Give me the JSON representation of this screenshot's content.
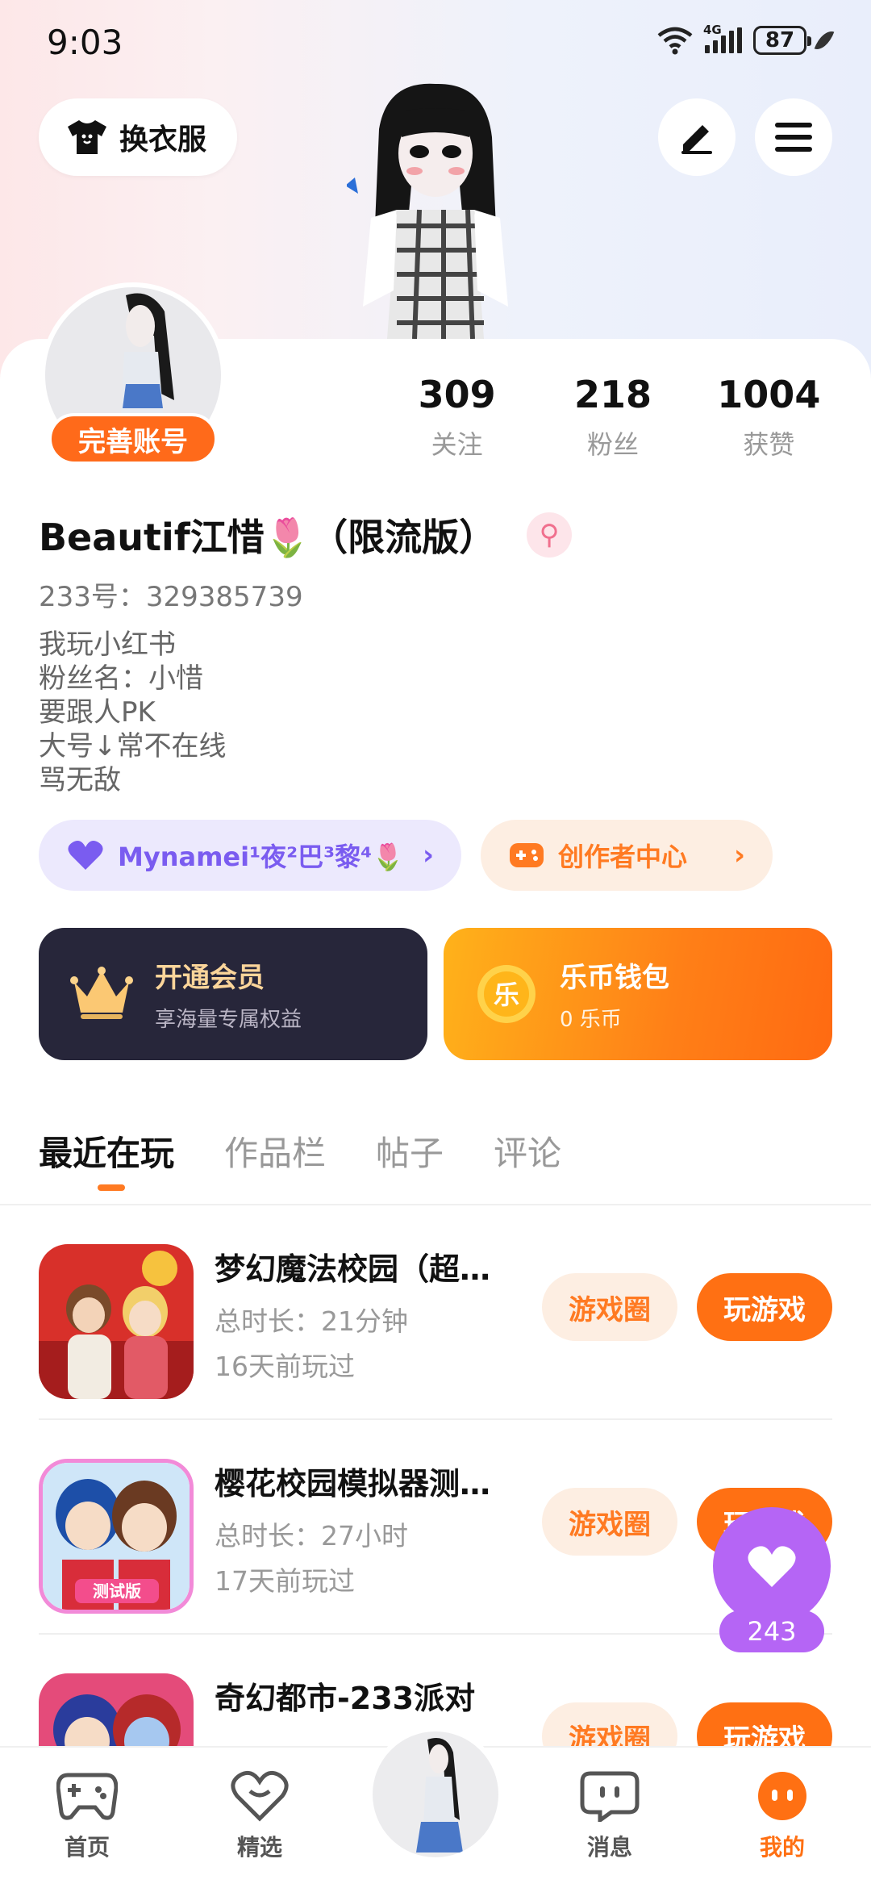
{
  "status_bar": {
    "time": "9:03",
    "network": "4G",
    "battery": "87"
  },
  "header": {
    "wardrobe_label": "换衣服",
    "edit_icon": "pen-icon",
    "menu_icon": "menu-icon"
  },
  "profile": {
    "complete_label": "完善账号",
    "stats": [
      {
        "num": "309",
        "cap": "关注"
      },
      {
        "num": "218",
        "cap": "粉丝"
      },
      {
        "num": "1004",
        "cap": "获赞"
      }
    ],
    "username": "Beautif江惜🌷（限流版）",
    "gender_symbol": "⚲",
    "uid": "233号：329385739",
    "bio": [
      "我玩小红书",
      "粉丝名：小惜",
      "要跟人PK",
      "大号↓常不在线",
      "骂无敌"
    ]
  },
  "pills": {
    "fan_group": "Mynamei¹夜²巴³黎⁴🌷",
    "creator": "创作者中心"
  },
  "cards": {
    "vip_title": "开通会员",
    "vip_sub": "享海量专属权益",
    "wallet_title": "乐币钱包",
    "wallet_sub": "0 乐币",
    "wallet_coin": "乐"
  },
  "tabs": [
    "最近在玩",
    "作品栏",
    "帖子",
    "评论"
  ],
  "games": [
    {
      "title": "梦幻魔法校园（超…",
      "duration": "总时长：21分钟",
      "last": "16天前玩过"
    },
    {
      "title": "樱花校园模拟器测…",
      "duration": "总时长：27小时",
      "last": "17天前玩过",
      "badge": "测试版"
    },
    {
      "title": "奇幻都市-233派对",
      "duration": "",
      "last": ""
    }
  ],
  "buttons": {
    "circle": "游戏圈",
    "play": "玩游戏"
  },
  "float_like": {
    "count": "243"
  },
  "bottom_nav": [
    "首页",
    "精选",
    "消息",
    "我的"
  ],
  "colors": {
    "accent": "#ff7013",
    "purple": "#b565f5",
    "vip_bg": "#27263a"
  }
}
